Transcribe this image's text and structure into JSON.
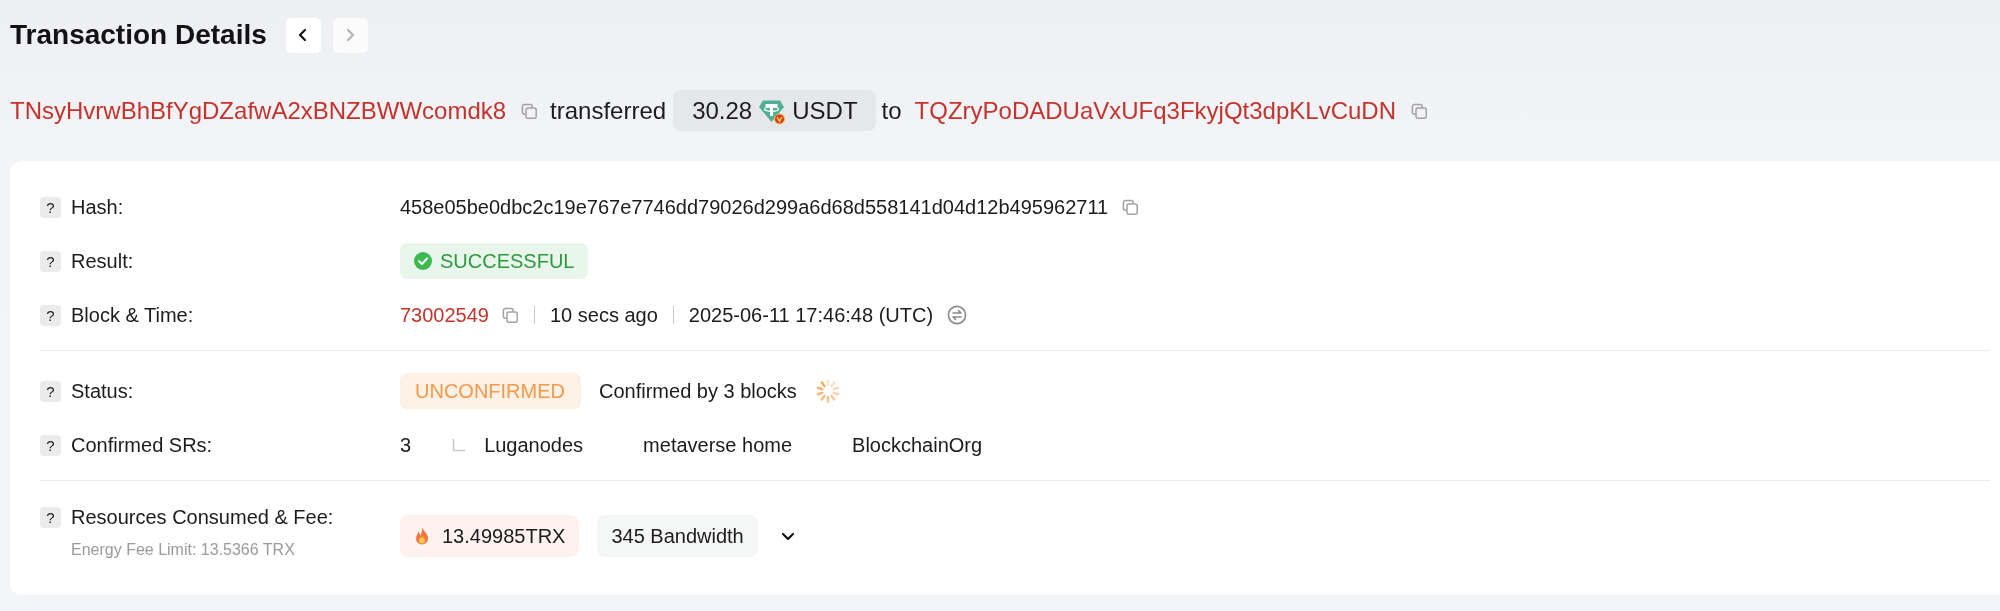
{
  "header": {
    "title": "Transaction Details",
    "nav": [
      {
        "kind": "prev",
        "disabled": false
      },
      {
        "kind": "next",
        "disabled": true
      }
    ]
  },
  "summary": {
    "from": "TNsyHvrwBhBfYgDZafwA2xBNZBWWcomdk8",
    "verb": "transferred",
    "amount": "30.28",
    "token": "USDT",
    "preposition": "to",
    "to": "TQZryPoDADUaVxUFq3FkyjQt3dpKLvCuDN"
  },
  "details": {
    "sections": [
      {
        "rows": [
          {
            "kind": "hash",
            "help": "?",
            "label": "Hash:",
            "value": "458e05be0dbc2c19e767e7746dd79026d299a6d68d558141d04d12b495962711"
          },
          {
            "kind": "result",
            "help": "?",
            "label": "Result:",
            "badge": "SUCCESSFUL",
            "succeeded": true
          },
          {
            "kind": "block",
            "help": "?",
            "label": "Block & Time:",
            "block": "73002549",
            "age": "10 secs ago",
            "timestamp": "2025-06-11 17:46:48 (UTC)"
          }
        ]
      },
      {
        "rows": [
          {
            "kind": "status",
            "help": "?",
            "label": "Status:",
            "badge": "UNCONFIRMED",
            "confirmed": false,
            "confirmations": "Confirmed by 3 blocks",
            "loading": true
          },
          {
            "kind": "srs",
            "help": "?",
            "label": "Confirmed SRs:",
            "count": "3",
            "names": [
              "Luganodes",
              "metaverse home",
              "BlockchainOrg"
            ]
          }
        ]
      },
      {
        "rows": [
          {
            "kind": "fee",
            "help": "?",
            "label": "Resources Consumed & Fee:",
            "note": "Energy Fee Limit: 13.5366 TRX",
            "fee": "13.49985TRX",
            "bandwidth": "345 Bandwidth",
            "expanded": false
          }
        ]
      }
    ]
  }
}
